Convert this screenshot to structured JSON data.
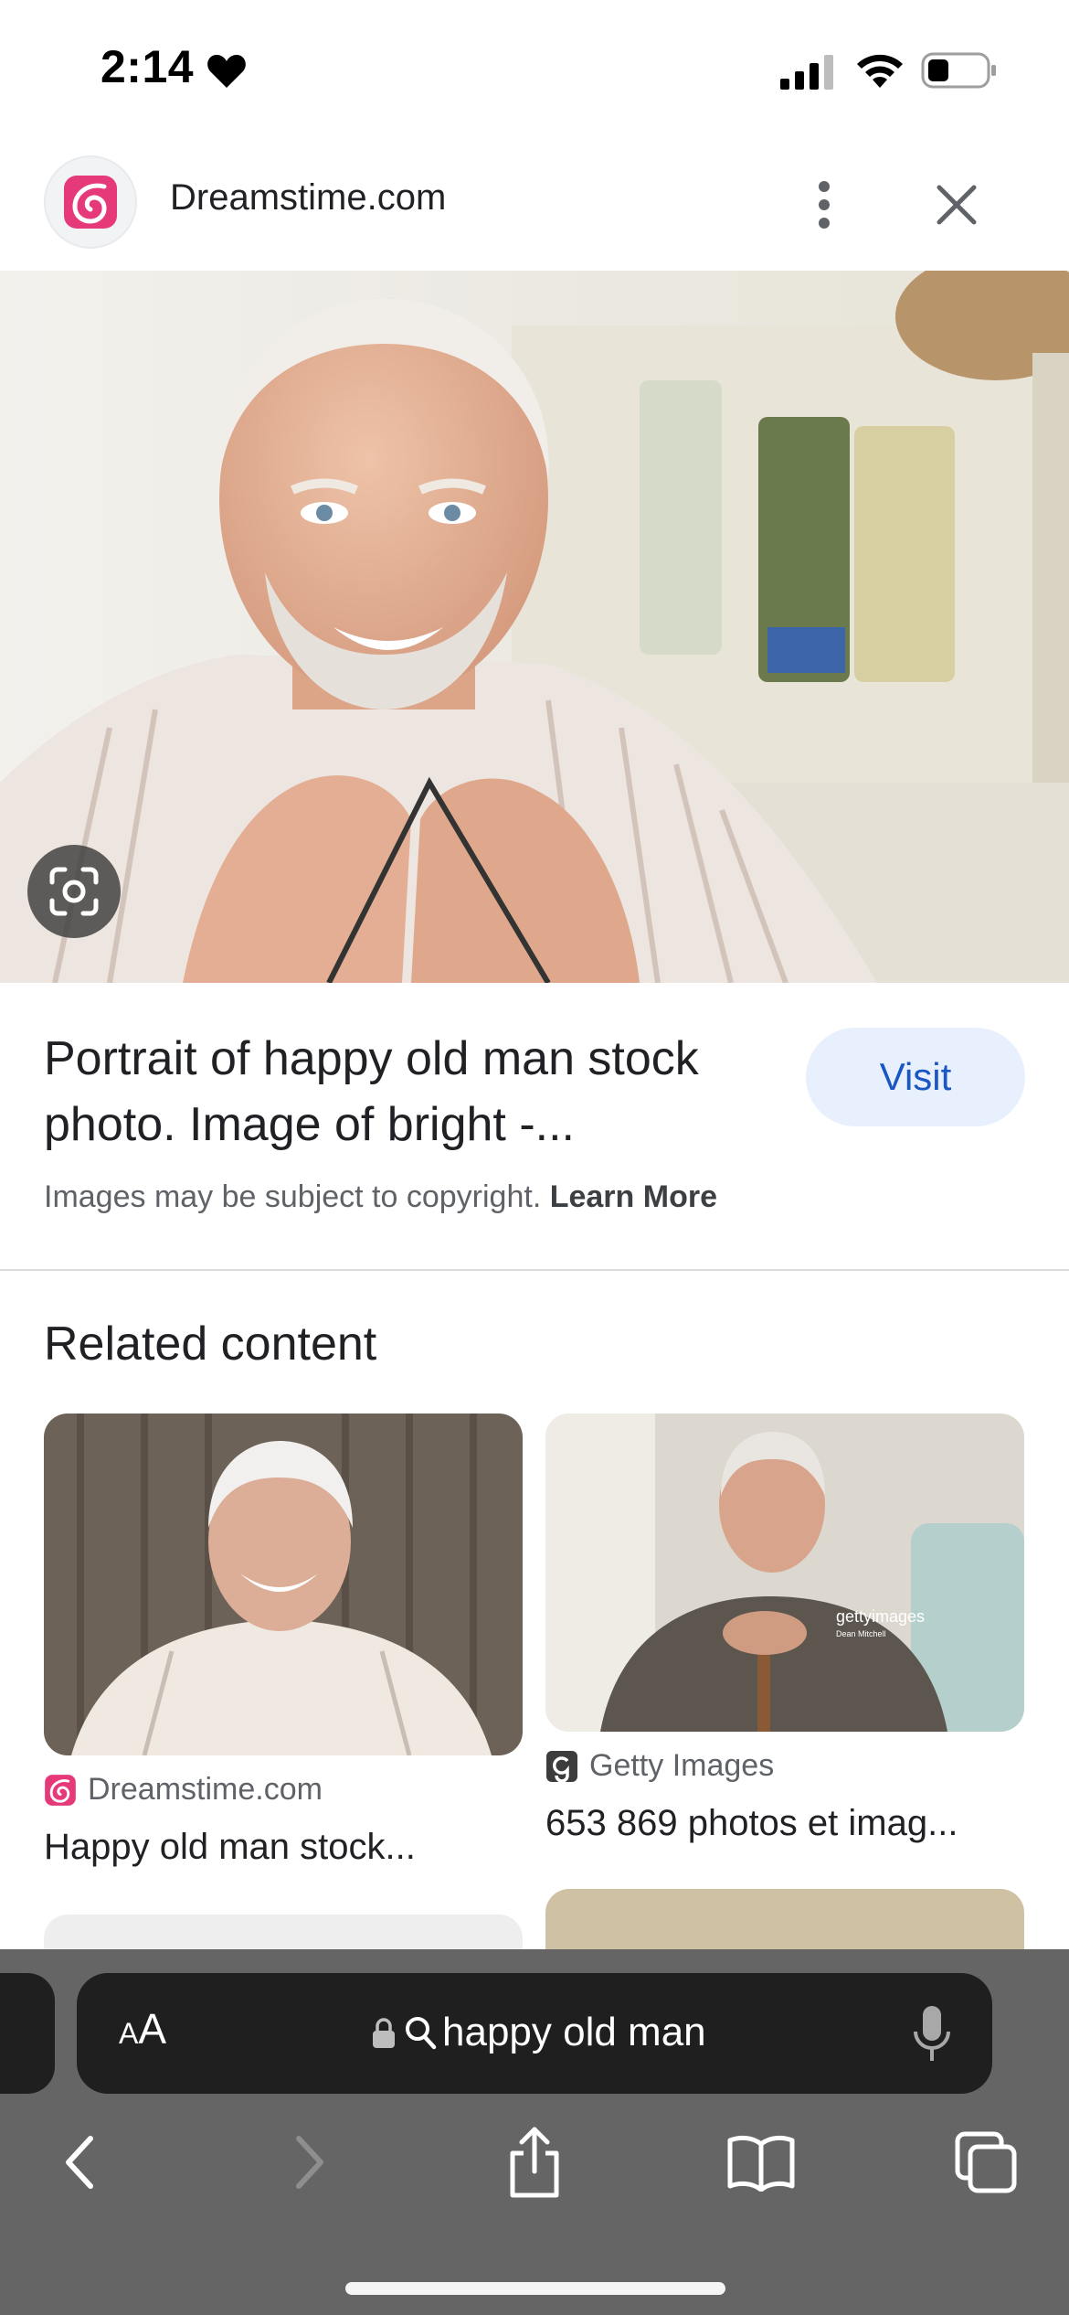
{
  "status_bar": {
    "time": "2:14"
  },
  "header": {
    "source_name": "Dreamstime.com",
    "logo_icon": "dreamstime-swirl-icon",
    "more_icon": "more-vert-icon",
    "close_icon": "close-icon"
  },
  "main_image": {
    "alt": "Portrait of happy old man",
    "lens_icon": "google-lens-icon"
  },
  "result": {
    "title": "Portrait of happy old man stock photo. Image of bright -...",
    "visit_label": "Visit",
    "copyright_text": "Images may be subject to copyright.",
    "learn_more_label": "Learn More"
  },
  "related": {
    "heading": "Related content",
    "items": [
      {
        "source": "Dreamstime.com",
        "source_icon": "dreamstime-swirl-icon",
        "title": "Happy old man stock..."
      },
      {
        "source": "Getty Images",
        "source_icon": "getty-g-icon",
        "title": "653 869 photos et imag...",
        "watermark": "gettyimages",
        "watermark_sub": "Dean Mitchell"
      }
    ]
  },
  "toolbar": {
    "aa_small": "A",
    "aa_large": "A",
    "address": "happy old man"
  },
  "colors": {
    "accent_blue": "#1a56c4",
    "visit_bg": "#e8f0fe",
    "dreamstime_pink": "#e6397a",
    "toolbar_bg": "#656565"
  }
}
